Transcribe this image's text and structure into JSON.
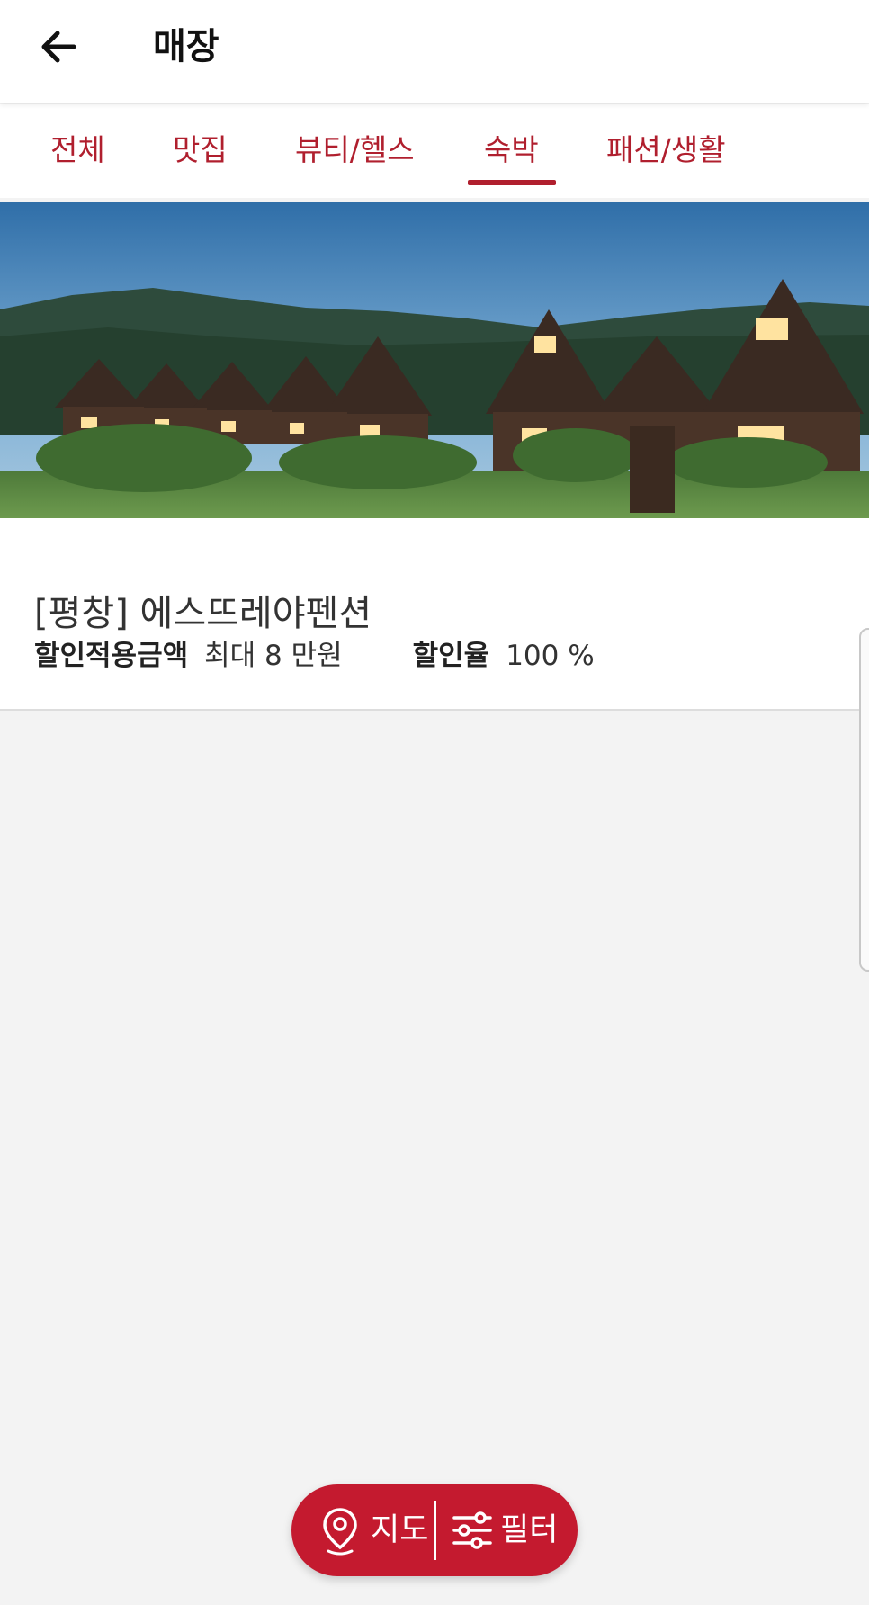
{
  "header": {
    "title": "매장"
  },
  "tabs": [
    {
      "label": "전체",
      "active": false
    },
    {
      "label": "맛집",
      "active": false
    },
    {
      "label": "뷰티/헬스",
      "active": false
    },
    {
      "label": "숙박",
      "active": true
    },
    {
      "label": "패션/생활",
      "active": false
    }
  ],
  "store": {
    "name": "[평창] 에스뜨레야펜션",
    "discount_amount_label": "할인적용금액",
    "discount_amount_value": "최대 8 만원",
    "discount_rate_label": "할인율",
    "discount_rate_value": "100 %"
  },
  "bottom_bar": {
    "map_label": "지도",
    "filter_label": "필터"
  },
  "colors": {
    "accent": "#b01f2e",
    "pill": "#c41a2f",
    "background": "#f3f3f3"
  }
}
